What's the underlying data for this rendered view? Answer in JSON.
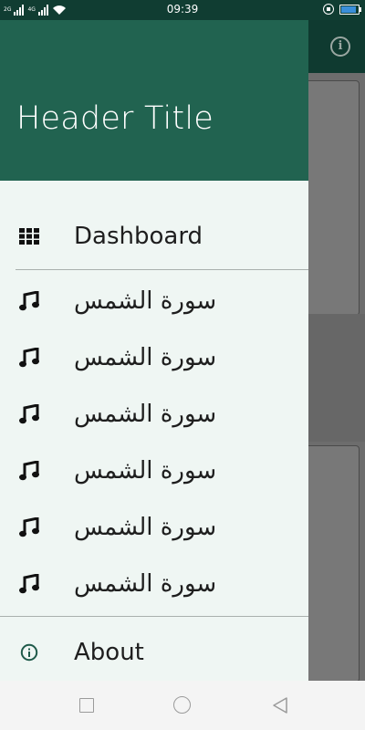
{
  "status_bar": {
    "time": "09:39",
    "network_labels": [
      "2G",
      "4G"
    ],
    "icons": [
      "signal-icon",
      "signal-icon",
      "wifi-icon",
      "rotation-lock-icon",
      "battery-icon"
    ],
    "battery_level": 0.9,
    "battery_color": "#3a8fd9"
  },
  "app": {
    "toolbar_icon": "info-icon",
    "toolbar_color": "#0f3a30"
  },
  "drawer": {
    "header_title": "Header Title",
    "header_color": "#216350",
    "items": [
      {
        "label": "Dashboard",
        "icon": "grid-icon"
      },
      {
        "label": "سورة الشمس",
        "icon": "music-note-icon"
      },
      {
        "label": "سورة الشمس",
        "icon": "music-note-icon"
      },
      {
        "label": "سورة الشمس",
        "icon": "music-note-icon"
      },
      {
        "label": "سورة الشمس",
        "icon": "music-note-icon"
      },
      {
        "label": "سورة الشمس",
        "icon": "music-note-icon"
      },
      {
        "label": "سورة الشمس",
        "icon": "music-note-icon"
      }
    ],
    "footer_item": {
      "label": "About",
      "icon": "info-icon"
    }
  },
  "nav_bar": {
    "buttons": [
      "recents-icon",
      "home-icon",
      "back-icon"
    ]
  }
}
